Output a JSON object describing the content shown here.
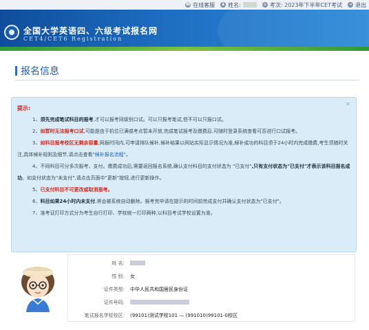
{
  "topbar": {
    "service": "在线客服",
    "name_label": "姓名:",
    "exam_label": "考次: 2023年下半年CET考试",
    "logout": "退出"
  },
  "header": {
    "title_cn": "全国大学英语四、六级考试报名网",
    "title_en": "CET4/CET6  Registration"
  },
  "page": {
    "title": "报名信息"
  },
  "notice": {
    "heading": "提示:",
    "items": [
      {
        "no": "1、",
        "bold": "须先完成笔试科目的报考",
        "rest": ",才可以报考同级别口试。可以只报考笔试,但不可以只报口试。"
      },
      {
        "no": "2、",
        "red": "如暂时无法报考口试",
        "rest": ",可能是由于机位已满或考点暂未开放,完成笔试报考及缴费后,可随时登录系统查看可否进行口试报考。"
      },
      {
        "no": "3、",
        "red": "如科目报考校区无剩余容量",
        "rest1": ",网报时间内,可申请排队候补,候补结果以网站实际显示情况为准,候补成功的科目须于24小时内完成缴费,考生须随时关注,具体候补规则及细节,请点击查看",
        "link": "\"候补报名流程\"",
        "rest2": "。"
      },
      {
        "no": "4、",
        "rest1": "不同科目可分多次报考、支付。缴费成功后,需要返回报名系统,确认支付科目的支付状态为 \"已支付\"",
        "bold": ",只有支付状态为\"已支付\"才表示该科目报名成功",
        "rest2": "。如支付状态为\"未支付\",请点击页面中\"更新\"按钮,进行更新操作。"
      },
      {
        "no": "5、",
        "red": "已支付科目不可更改或取消报考。"
      },
      {
        "no": "6、",
        "bold": "科目如果24小时内未支付",
        "rest": ",将会被系统自动删除。报考完毕请在提示的时间前完成支付并确认支付状态为\"已支付\"。"
      },
      {
        "no": "7、",
        "rest": "准考证打印方式分为考生自行打印、学校统一打印两种,以科目考试学校设置为准。"
      }
    ]
  },
  "info": {
    "rows": [
      {
        "label": "姓    名:",
        "value": ""
      },
      {
        "label": "性    别:",
        "value": "女"
      },
      {
        "label": "证件类型:",
        "value": "中华人民共和国居民身份证"
      },
      {
        "label": "证件号码:",
        "value": ""
      },
      {
        "label": "笔试报名学校校区:",
        "value": "(99101)测试学校101 — (991010)99101-0校区"
      }
    ]
  },
  "colors": {
    "header_blue": "#1e6ec2",
    "title_blue": "#1f5fae",
    "notice_bg": "#d9ecf7",
    "warn_red": "#d0281f"
  }
}
